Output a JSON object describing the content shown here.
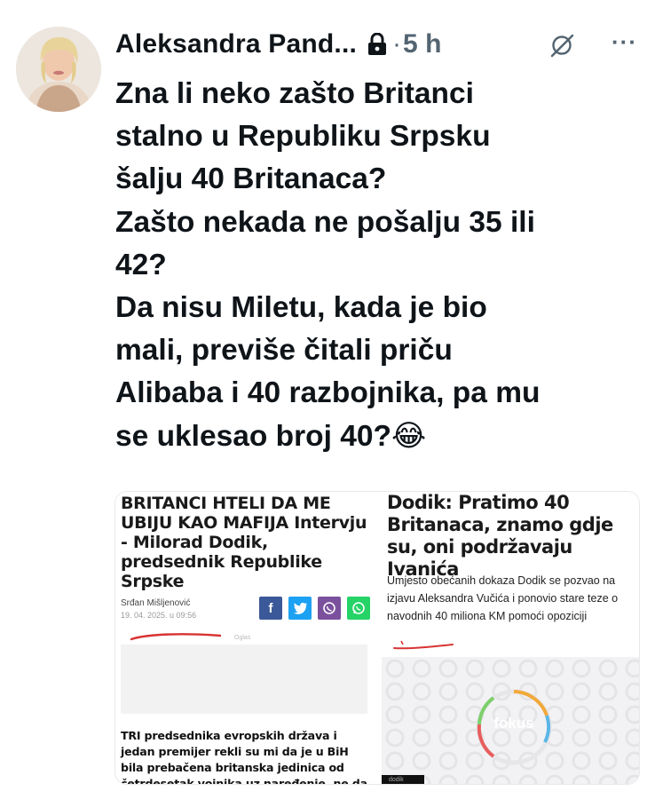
{
  "post": {
    "author": "Aleksandra Pand...",
    "separator": "·",
    "time": "5 h",
    "more": "···",
    "text": "Zna li neko zašto Britanci\nstalno u Republiku Srpsku\nšalju 40 Britanaca?\nZašto nekada ne pošalju 35 ili\n42?\nDa nisu Miletu, kada je bio\nmali, previše čitali priču\nAlibaba i 40 razbojnika, pa mu\nse uklesao broj 40?😂"
  },
  "media": {
    "left": {
      "title": "BRITANCI HTELI DA ME UBIJU KAO MAFIJA Intervju - Milorad Dodik, predsednik Republike Srpske",
      "author": "Srđan Mišljenović",
      "date": "19. 04. 2025. u 09:56",
      "share": [
        "f",
        "t",
        "v",
        "w"
      ],
      "ad_label": "Oglas",
      "body": "TRI predsednika evropskih država i jedan premijer rekli su mi da je u BiH bila prebačena britanska jedinica od četrdesetak vojnika uz naređenje, ne da me uhapse, već da me"
    },
    "right": {
      "title": "Dodik: Pratimo 40 Britanaca, znamo gdje su, oni podržavaju Ivanića",
      "subtitle": "Umjesto obećanih dokaza Dodik se pozvao na izjavu Aleksandra Vučića i ponovio stare teze o navodnih 40 miliona KM pomoći opoziciji",
      "logo": "fokus",
      "caption": "dodik"
    }
  },
  "colors": {
    "facebook": "#3b5998",
    "twitter": "#1da1f2",
    "viber": "#7b519d",
    "whatsapp": "#25d366",
    "text": "#0f1419",
    "muted": "#536471"
  }
}
